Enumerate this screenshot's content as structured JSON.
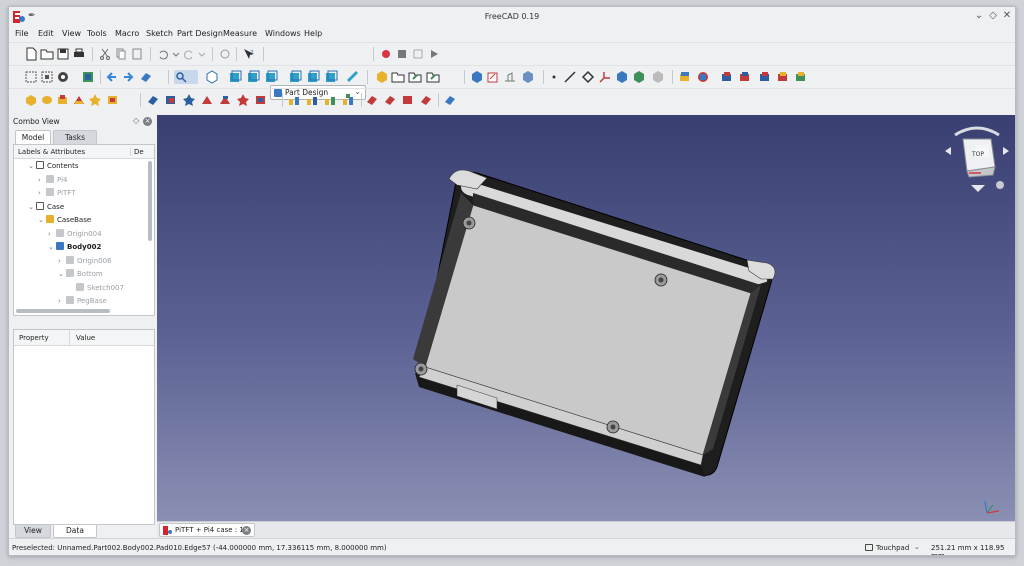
{
  "window": {
    "title": "FreeCAD 0.19"
  },
  "menu": [
    "File",
    "Edit",
    "View",
    "Tools",
    "Macro",
    "Sketch",
    "Part Design",
    "Measure",
    "Windows",
    "Help"
  ],
  "workbench": {
    "selected": "Part Design"
  },
  "combo_view": {
    "title": "Combo View",
    "tabs": [
      "Model",
      "Tasks"
    ],
    "tree_headers": [
      "Labels & Attributes",
      "De"
    ],
    "tree": [
      {
        "label": "Contents",
        "icon": "folder-icon",
        "level": 1,
        "twisty": "v",
        "dim": false,
        "bold": false
      },
      {
        "label": "Pi4",
        "icon": "part-icon",
        "level": 2,
        "twisty": ">",
        "dim": true,
        "bold": false
      },
      {
        "label": "PiTFT",
        "icon": "part-icon",
        "level": 2,
        "twisty": ">",
        "dim": true,
        "bold": false
      },
      {
        "label": "Case",
        "icon": "folder-icon",
        "level": 1,
        "twisty": "v",
        "dim": false,
        "bold": false
      },
      {
        "label": "CaseBase",
        "icon": "part-icon",
        "level": 2,
        "twisty": "v",
        "dim": false,
        "bold": false
      },
      {
        "label": "Origin004",
        "icon": "origin-icon",
        "level": 3,
        "twisty": ">",
        "dim": true,
        "bold": false
      },
      {
        "label": "Body002",
        "icon": "body-icon",
        "level": 3,
        "twisty": "v",
        "dim": false,
        "bold": true
      },
      {
        "label": "Origin006",
        "icon": "origin-icon",
        "level": 4,
        "twisty": ">",
        "dim": true,
        "bold": false
      },
      {
        "label": "Bottom",
        "icon": "pad-icon",
        "level": 4,
        "twisty": "v",
        "dim": true,
        "bold": false
      },
      {
        "label": "Sketch007",
        "icon": "sketch-icon",
        "level": 5,
        "twisty": "",
        "dim": true,
        "bold": false
      },
      {
        "label": "PegBase",
        "icon": "pad-icon",
        "level": 4,
        "twisty": ">",
        "dim": true,
        "bold": false
      }
    ],
    "property_headers": [
      "Property",
      "Value"
    ],
    "bottom_tabs": [
      "View",
      "Data"
    ]
  },
  "document_tab": {
    "label": "PiTFT + Pi4 case : 1"
  },
  "status": {
    "preselected": "Preselected: Unnamed.Part002.Body002.Pad010.Edge57 (-44.000000 mm, 17.336115 mm, 8.000000 mm)",
    "navigation": "Touchpad",
    "dimensions": "251.21 mm x 118.95 mm"
  },
  "navcube": {
    "face": "TOP"
  },
  "colors": {
    "viewport_top": "#3a3f72",
    "viewport_bottom": "#8a90b3",
    "model": "#c9c9c9",
    "record": "#d9343f"
  }
}
